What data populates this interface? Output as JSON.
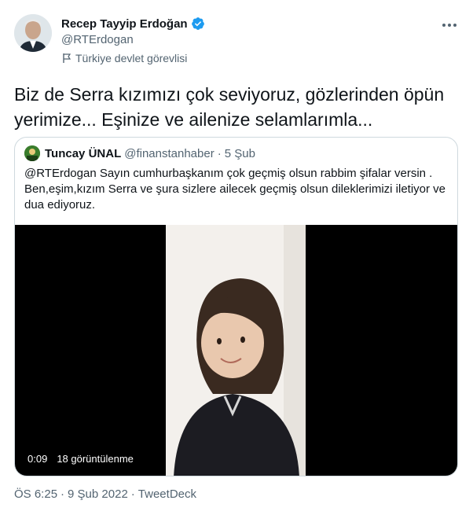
{
  "author": {
    "name": "Recep Tayyip Erdoğan",
    "handle": "@RTErdogan",
    "label": "Türkiye devlet görevlisi",
    "verified": true
  },
  "tweet": {
    "text": "Biz de Serra kızımızı çok seviyoruz, gözlerinden öpün yerimize... Eşinize ve ailenize selamlarımla...",
    "time": "ÖS 6:25",
    "date": "9 Şub 2022",
    "source": "TweetDeck",
    "separator": "·"
  },
  "quote": {
    "name": "Tuncay ÜNAL",
    "handle": "@finanstanhaber",
    "separator": "·",
    "date": "5 Şub",
    "text": "@RTErdogan Sayın cumhurbaşkanım çok geçmiş olsun rabbim şifalar versin . Ben,eşim,kızım Serra ve şura sizlere ailecek geçmiş olsun dileklerimizi iletiyor ve dua ediyoruz.",
    "video": {
      "duration": "0:09",
      "views": "18 görüntülenme"
    }
  },
  "colors": {
    "verified": "#1d9bf0",
    "secondary_text": "#536471",
    "border": "#cfd9de"
  },
  "icons": [
    "verified-badge-icon",
    "government-flag-icon",
    "more-options-icon"
  ]
}
